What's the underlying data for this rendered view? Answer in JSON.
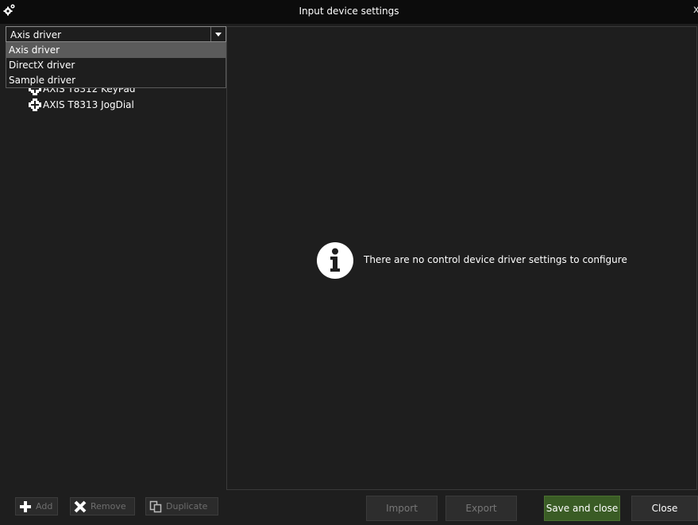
{
  "window": {
    "title": "Input device settings",
    "close_glyph": "x",
    "icon": "gears-icon"
  },
  "driver_select": {
    "value": "Axis driver",
    "options": [
      "Axis driver",
      "DirectX driver",
      "Sample driver"
    ],
    "selected_index": 0
  },
  "devices": [
    {
      "label": "AXIS T8312 KeyPad",
      "icon": "device-icon"
    },
    {
      "label": "AXIS T8313 JogDial",
      "icon": "device-icon"
    }
  ],
  "info": {
    "message": "There are no control device driver settings to configure",
    "icon": "info-icon"
  },
  "toolbar": {
    "add": "Add",
    "remove": "Remove",
    "duplicate": "Duplicate"
  },
  "footer": {
    "import": "Import",
    "export": "Export",
    "save_close": "Save and close",
    "close": "Close"
  },
  "colors": {
    "background": "#1e1e1e",
    "titlebar": "#0c0c0c",
    "selected_option": "#5b5b5b",
    "primary_button": "#3a5c25"
  }
}
